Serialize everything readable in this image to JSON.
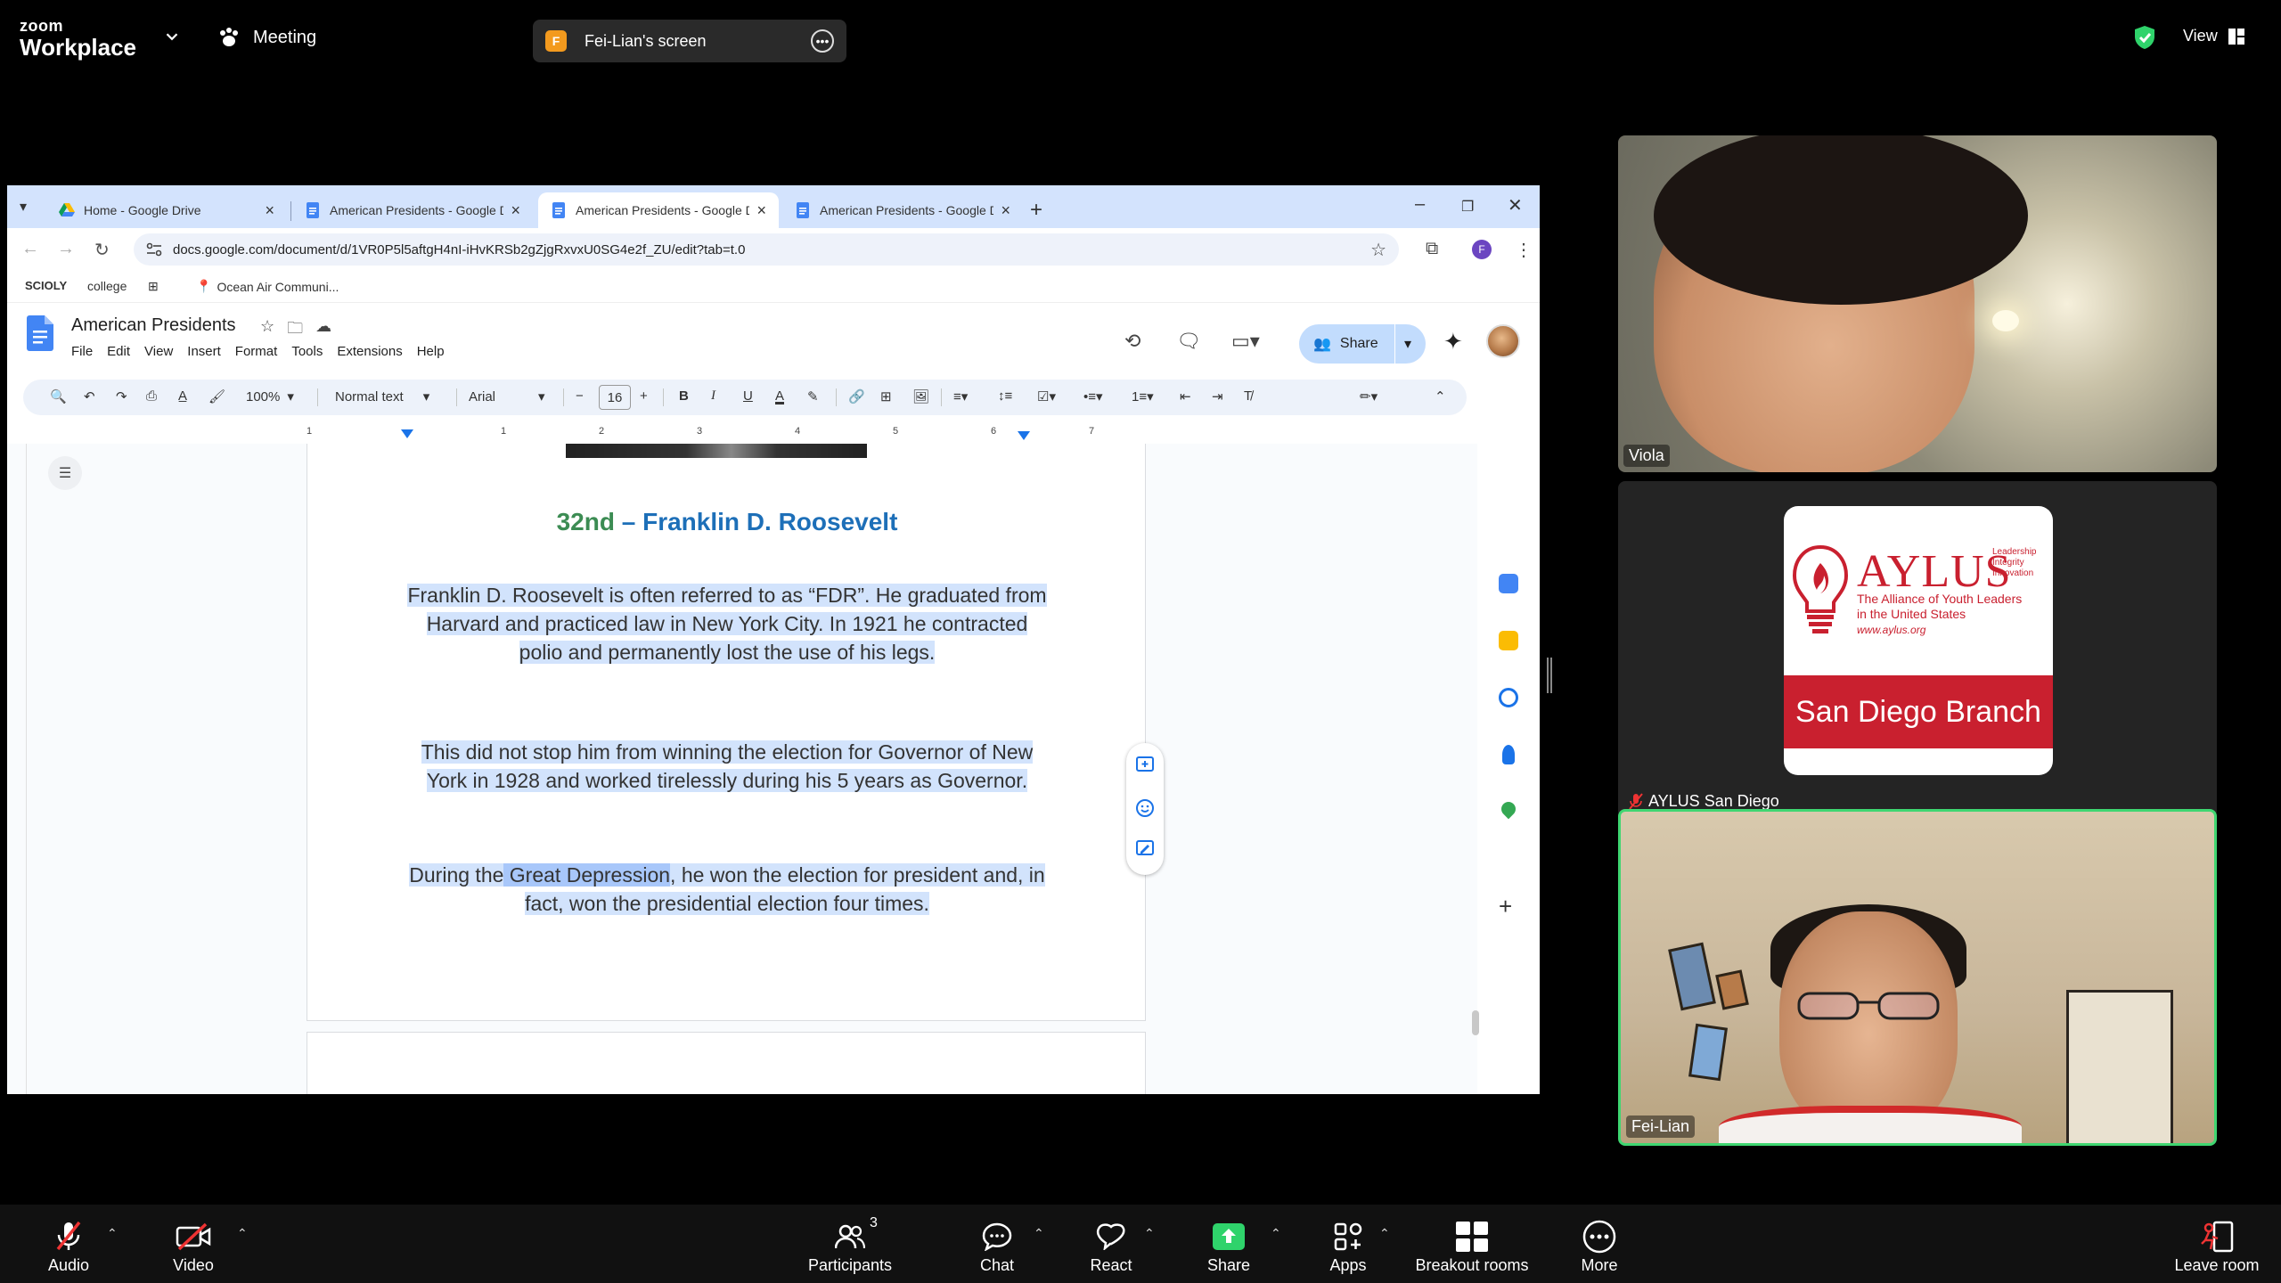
{
  "zoom": {
    "logo_small": "zoom",
    "logo_big": "Workplace",
    "meeting_label": "Meeting",
    "presenter_initial": "F",
    "screen_label": "Fei-Lian's screen",
    "view_label": "View"
  },
  "browser": {
    "tabs": [
      {
        "title": "Home - Google Drive",
        "active": false
      },
      {
        "title": "American Presidents - Google D",
        "active": false
      },
      {
        "title": "American Presidents - Google D",
        "active": true
      },
      {
        "title": "American Presidents - Google D",
        "active": false
      }
    ],
    "url": "docs.google.com/document/d/1VR0P5l5aftgH4nI-iHvKRSb2gZjgRxvxU0SG4e2f_ZU/edit?tab=t.0",
    "profile_initial": "F",
    "bookmarks": [
      "SCIOLY",
      "college",
      "Ocean Air Communi..."
    ]
  },
  "docs": {
    "title": "American Presidents",
    "menu": [
      "File",
      "Edit",
      "View",
      "Insert",
      "Format",
      "Tools",
      "Extensions",
      "Help"
    ],
    "share_label": "Share",
    "toolbar": {
      "zoom": "100%",
      "style": "Normal text",
      "font": "Arial",
      "font_size": "16"
    },
    "ruler_numbers": [
      "1",
      "1",
      "2",
      "3",
      "4",
      "5",
      "6",
      "7"
    ],
    "heading_number": "32nd",
    "heading_rest": " – Franklin D. Roosevelt",
    "paragraph1": "Franklin D. Roosevelt is often referred to as “FDR”. He graduated from Harvard and practiced law in New York City. In 1921 he contracted polio and permanently lost the use of his legs.",
    "paragraph2": "This did not stop him from winning the election for Governor of New York in 1928 and worked tirelessly during his 5 years as Governor.",
    "paragraph3_before": "During the",
    "paragraph3_selected": " Great Depression",
    "paragraph3_after": ", he won the election for president and, in fact, won the presidential election four times."
  },
  "gallery": {
    "participants": [
      {
        "name": "Viola"
      },
      {
        "name": "AYLUS San Diego"
      },
      {
        "name": "Fei-Lian"
      }
    ],
    "aylus": {
      "word": "AYLUS",
      "tag": [
        "Leadership",
        "Integrity",
        "Innovation"
      ],
      "full_name_1": "The Alliance of Youth Leaders",
      "full_name_2": "in the United States",
      "url": "www.aylus.org",
      "branch": "San Diego Branch"
    }
  },
  "controls": {
    "audio": "Audio",
    "video": "Video",
    "participants": "Participants",
    "participants_count": "3",
    "chat": "Chat",
    "react": "React",
    "share": "Share",
    "apps": "Apps",
    "breakout": "Breakout rooms",
    "more": "More",
    "leave": "Leave room"
  },
  "colors": {
    "share_green": "#2fd36b",
    "active_speaker": "#3fd671",
    "aylus_red": "#c9202f",
    "docs_blue": "#1d6fb8",
    "heading_green": "#3c8c53"
  }
}
